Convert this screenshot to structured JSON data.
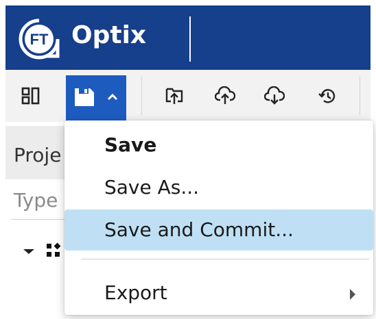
{
  "app": {
    "brand_name": "Optix",
    "logo_text": "FT",
    "header_color": "#163f8c"
  },
  "toolbar": {
    "icons": [
      "layout-icon",
      "save-icon",
      "chevron-up-icon",
      "upload-to-project-icon",
      "cloud-upload-icon",
      "cloud-download-icon",
      "history-icon"
    ],
    "accent": "#1d5bbf"
  },
  "left_panel": {
    "header_label": "Proje",
    "filter_placeholder": "Type"
  },
  "menu": {
    "items": [
      {
        "label": "Save",
        "bold": true
      },
      {
        "label": "Save As..."
      },
      {
        "label": "Save and Commit...",
        "highlighted": true
      },
      {
        "label": "Export",
        "has_submenu": true
      }
    ],
    "highlight_color": "#bfe0f4"
  }
}
